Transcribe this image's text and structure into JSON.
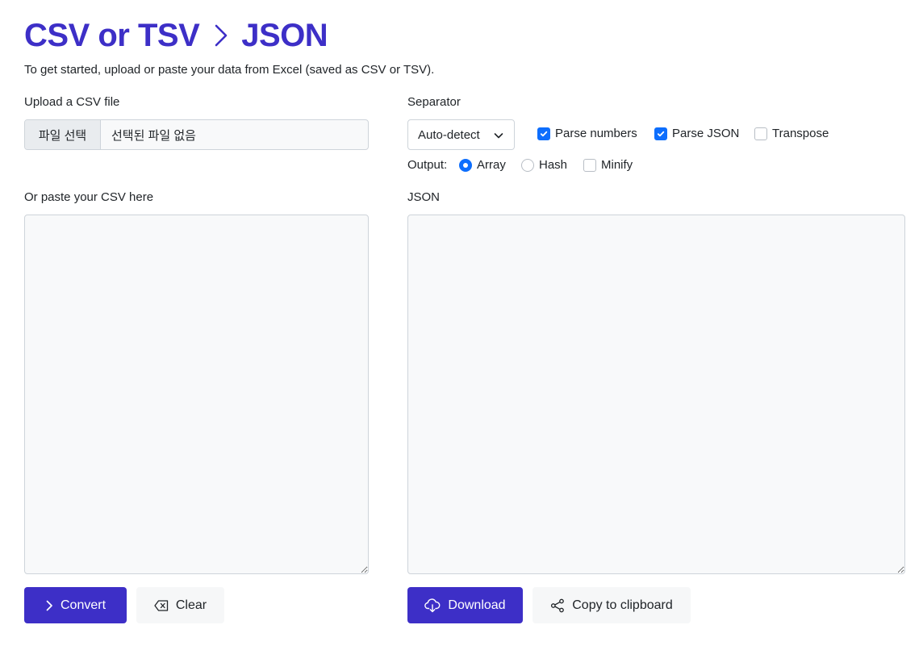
{
  "header": {
    "title_left": "CSV or TSV",
    "title_right": "JSON",
    "subtitle": "To get started, upload or paste your data from Excel (saved as CSV or TSV)."
  },
  "upload": {
    "label": "Upload a CSV file",
    "choose_button": "파일 선택",
    "no_file_text": "선택된 파일 없음"
  },
  "options": {
    "separator_label": "Separator",
    "separator_value": "Auto-detect",
    "parse_numbers": "Parse numbers",
    "parse_json": "Parse JSON",
    "transpose": "Transpose",
    "output_label": "Output:",
    "array": "Array",
    "hash": "Hash",
    "minify": "Minify"
  },
  "input_area": {
    "label": "Or paste your CSV here"
  },
  "output_area": {
    "label": "JSON"
  },
  "actions": {
    "convert": "Convert",
    "clear": "Clear",
    "download": "Download",
    "copy": "Copy to clipboard"
  },
  "colors": {
    "accent": "#3d2fc7",
    "checkbox": "#0d6efd"
  },
  "icons": {
    "title_separator": "chevron-right-icon",
    "select": "chevron-down-icon",
    "check": "checkmark-icon",
    "convert": "chevron-right-icon",
    "clear": "backspace-icon",
    "download": "cloud-download-icon",
    "copy": "share-icon"
  }
}
